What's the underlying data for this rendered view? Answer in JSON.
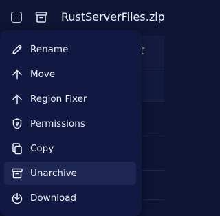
{
  "file": {
    "name": "RustServerFiles.zip"
  },
  "background": {
    "partial_letter": "t"
  },
  "menu": {
    "items": [
      {
        "label": "Rename",
        "icon": "pencil-icon"
      },
      {
        "label": "Move",
        "icon": "arrow-up-icon"
      },
      {
        "label": "Region Fixer",
        "icon": "arrow-up-icon"
      },
      {
        "label": "Permissions",
        "icon": "shield-icon"
      },
      {
        "label": "Copy",
        "icon": "copy-icon"
      },
      {
        "label": "Unarchive",
        "icon": "archive-icon",
        "active": true
      },
      {
        "label": "Download",
        "icon": "download-icon"
      }
    ]
  },
  "colors": {
    "background": "#0f1535",
    "menu": "#111842",
    "active_item": "#1e2654",
    "text": "#eef0f8"
  }
}
